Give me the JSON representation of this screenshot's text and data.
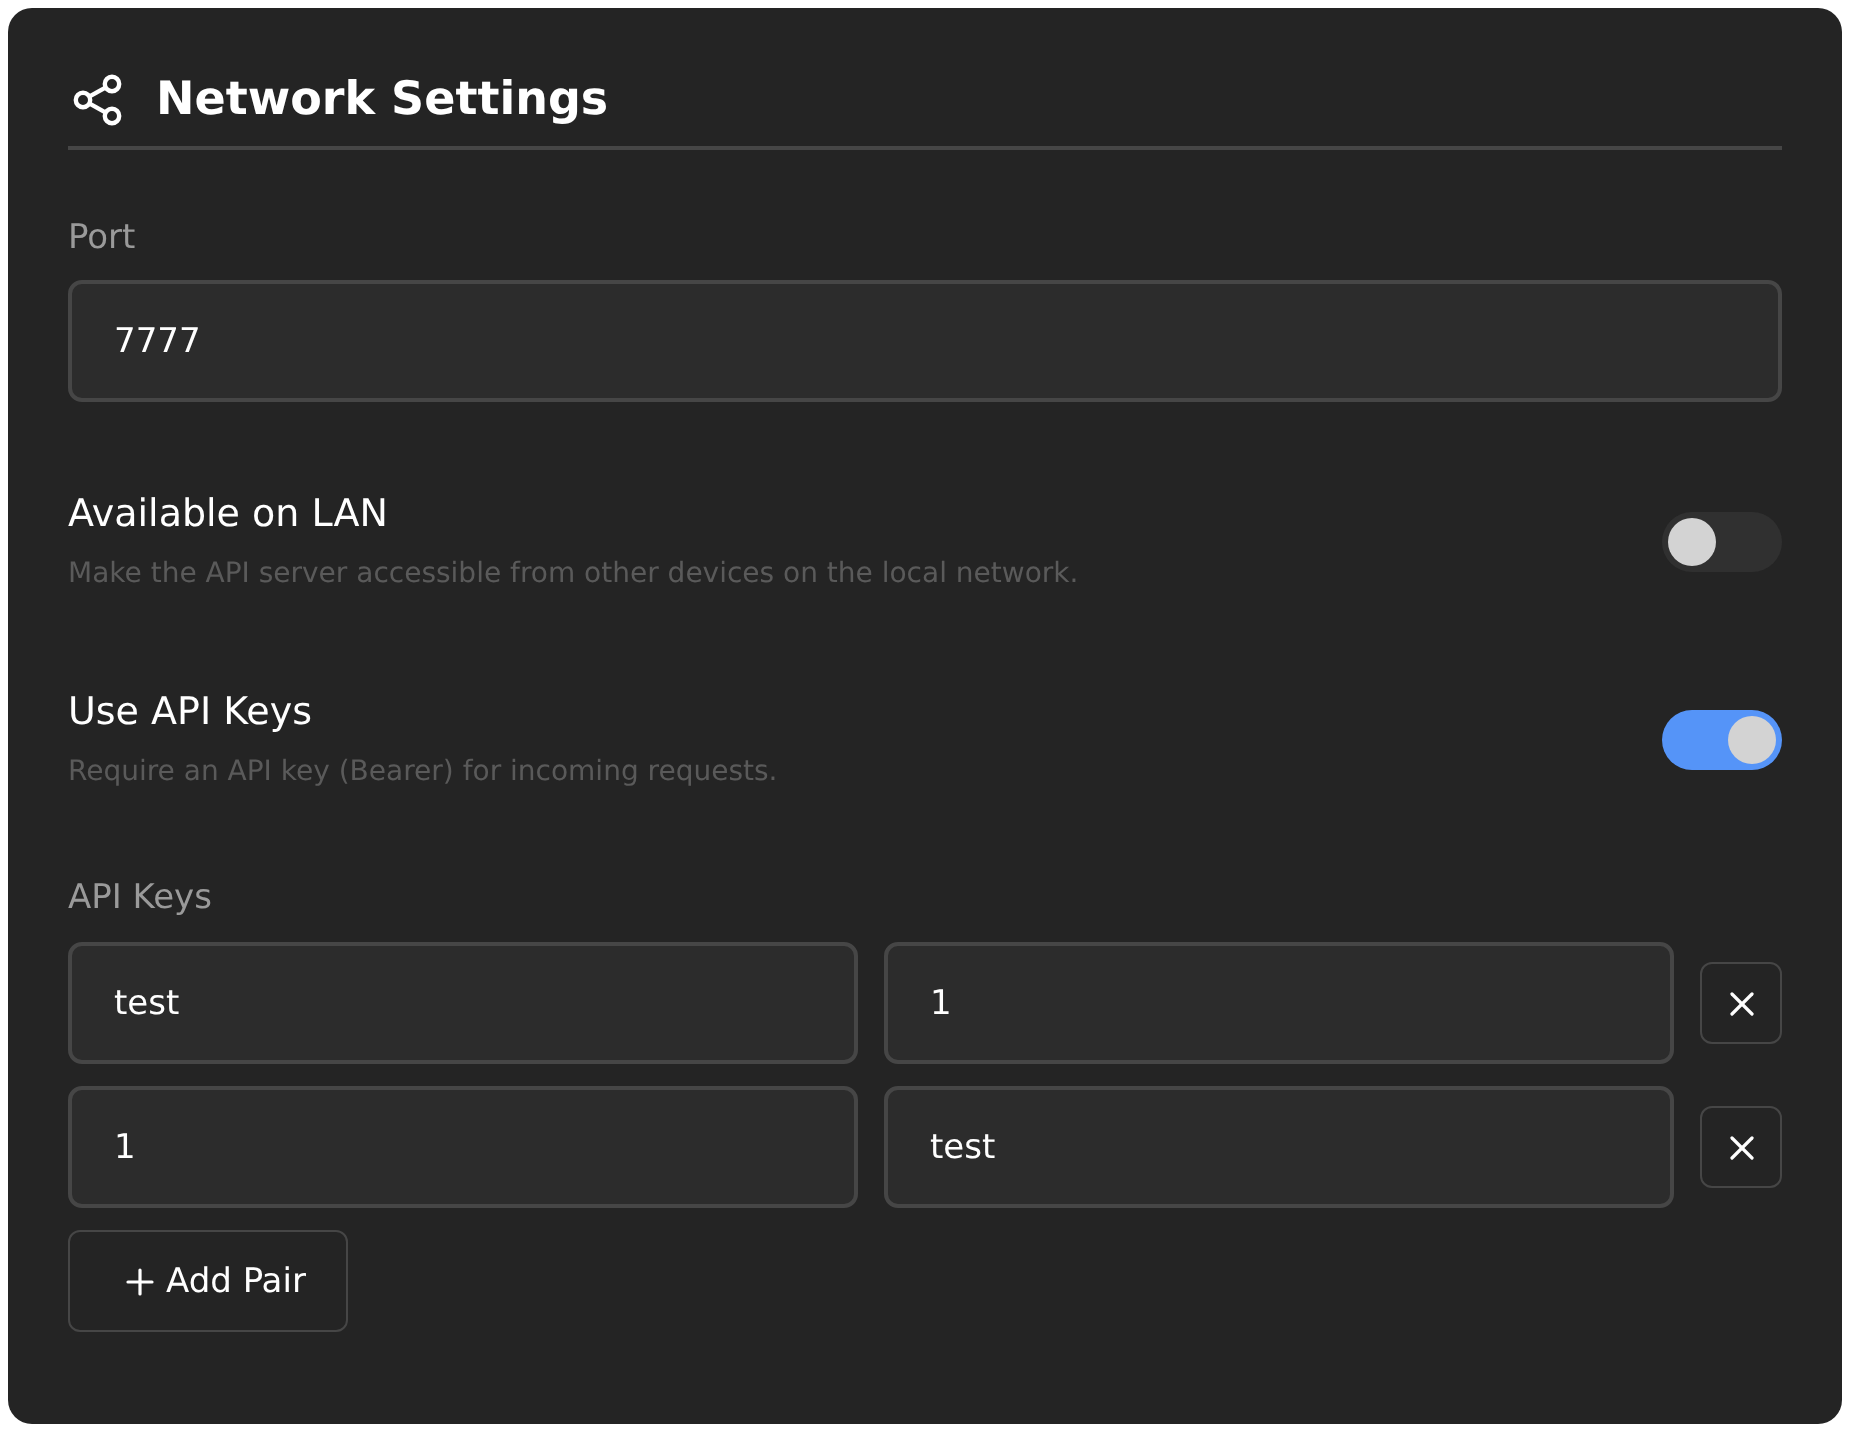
{
  "header": {
    "title": "Network Settings"
  },
  "port": {
    "label": "Port",
    "value": "7777"
  },
  "toggles": [
    {
      "title": "Available on LAN",
      "description": "Make the API server accessible from other devices on the local network.",
      "on": false
    },
    {
      "title": "Use API Keys",
      "description": "Require an API key (Bearer) for incoming requests.",
      "on": true
    }
  ],
  "api_keys": {
    "label": "API Keys",
    "pairs": [
      {
        "key": "test",
        "value": "1"
      },
      {
        "key": "1",
        "value": "test"
      }
    ],
    "add_button": {
      "label": "Add Pair"
    }
  }
}
